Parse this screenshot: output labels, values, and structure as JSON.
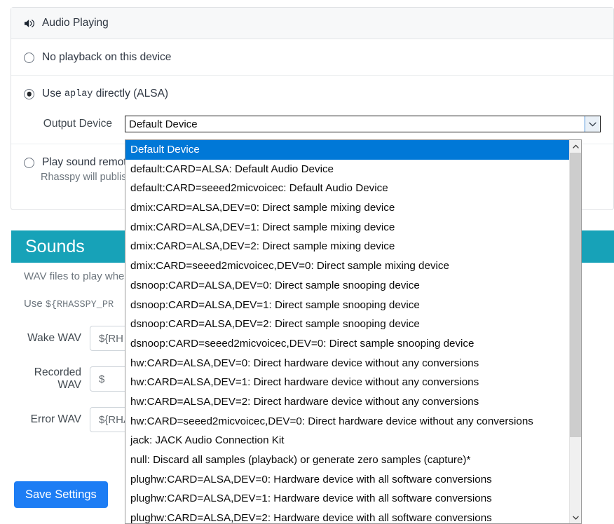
{
  "card": {
    "header_title": "Audio Playing",
    "header_icon": "speaker-volume-icon"
  },
  "options_group": {
    "no_playback": {
      "label": "No playback on this device",
      "checked": false
    },
    "aplay": {
      "label_pre": "Use",
      "label_code": "aplay",
      "label_post": "directly (ALSA)",
      "checked": true
    },
    "remote": {
      "label": "Play sound remotely",
      "helper": "Rhasspy will publish",
      "checked": false
    }
  },
  "output_device": {
    "label": "Output Device",
    "value": "Default Device",
    "arrow_icon": "chevron-down-icon",
    "open": true,
    "options": [
      "Default Device",
      "default:CARD=ALSA: Default Audio Device",
      "default:CARD=seeed2micvoicec: Default Audio Device",
      "dmix:CARD=ALSA,DEV=0: Direct sample mixing device",
      "dmix:CARD=ALSA,DEV=1: Direct sample mixing device",
      "dmix:CARD=ALSA,DEV=2: Direct sample mixing device",
      "dmix:CARD=seeed2micvoicec,DEV=0: Direct sample mixing device",
      "dsnoop:CARD=ALSA,DEV=0: Direct sample snooping device",
      "dsnoop:CARD=ALSA,DEV=1: Direct sample snooping device",
      "dsnoop:CARD=ALSA,DEV=2: Direct sample snooping device",
      "dsnoop:CARD=seeed2micvoicec,DEV=0: Direct sample snooping device",
      "hw:CARD=ALSA,DEV=0: Direct hardware device without any conversions",
      "hw:CARD=ALSA,DEV=1: Direct hardware device without any conversions",
      "hw:CARD=ALSA,DEV=2: Direct hardware device without any conversions",
      "hw:CARD=seeed2micvoicec,DEV=0: Direct hardware device without any conversions",
      "jack: JACK Audio Connection Kit",
      "null: Discard all samples (playback) or generate zero samples (capture)*",
      "plughw:CARD=ALSA,DEV=0: Hardware device with all software conversions",
      "plughw:CARD=ALSA,DEV=1: Hardware device with all software conversions",
      "plughw:CARD=ALSA,DEV=2: Hardware device with all software conversions"
    ],
    "selected_index": 0
  },
  "sounds": {
    "heading": "Sounds",
    "description": "WAV files to play when",
    "usage_pre": "Use",
    "usage_code": "${RHASSPY_PR",
    "fields": [
      {
        "label": "Wake WAV",
        "value": "${RH"
      },
      {
        "label": "Recorded WAV",
        "value": "$"
      },
      {
        "label": "Error WAV",
        "value": "${RHA"
      }
    ]
  },
  "footer": {
    "save_label": "Save Settings"
  },
  "colors": {
    "section_teal": "#17a2b8",
    "primary_blue": "#1d7df4",
    "highlight_blue": "#0078d7"
  }
}
